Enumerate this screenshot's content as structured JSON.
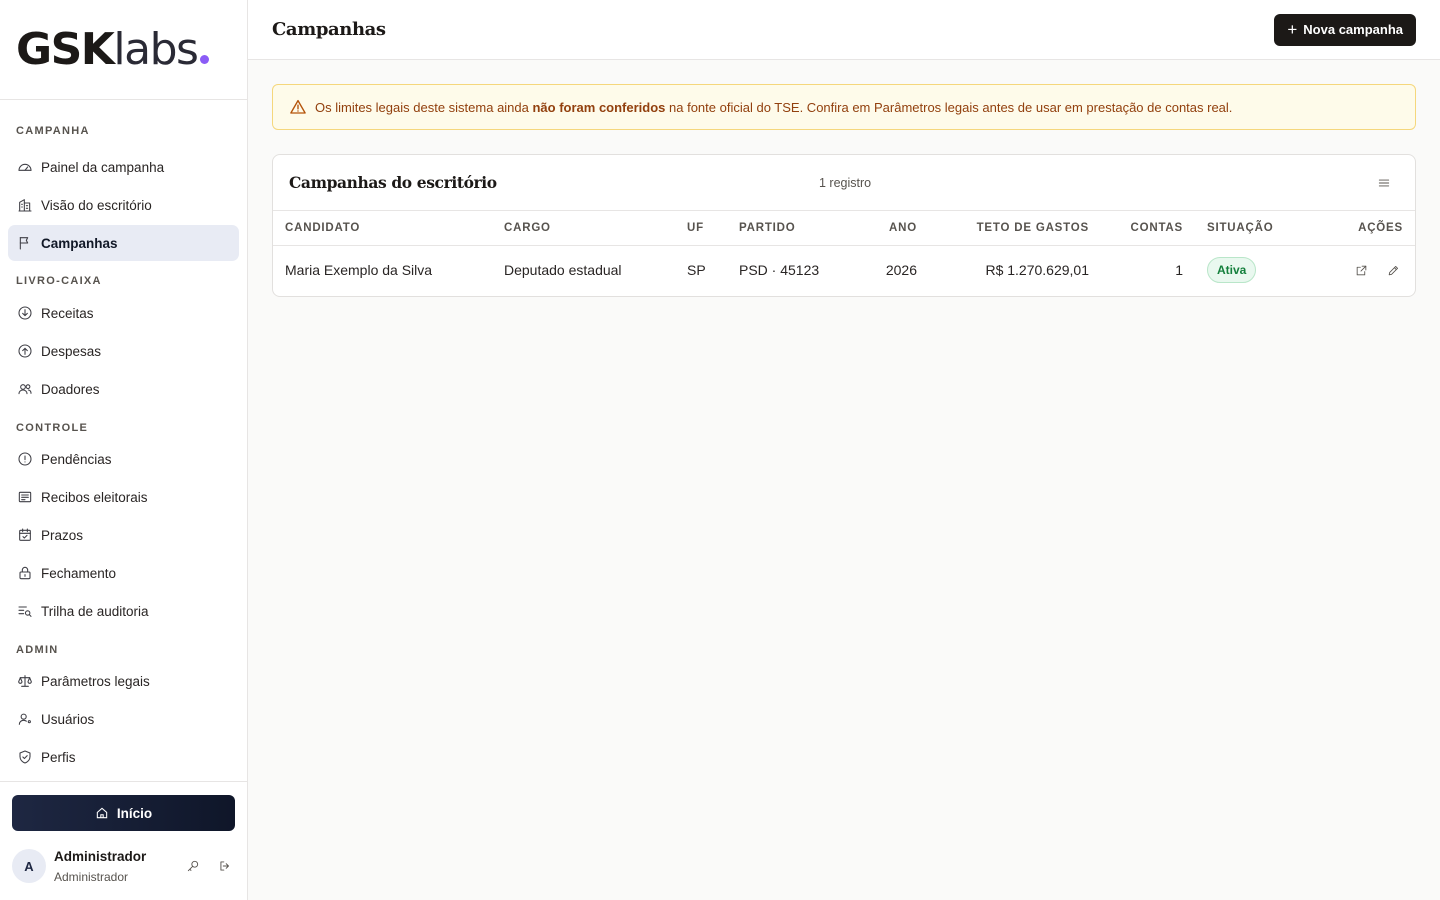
{
  "brand": {
    "bold": "GSK",
    "light": "labs",
    "dot_color": "#8b5cf6"
  },
  "sidebar": {
    "sections": [
      {
        "label": "CAMPANHA",
        "items": [
          {
            "label": "Painel da campanha",
            "icon": "gauge-icon"
          },
          {
            "label": "Visão do escritório",
            "icon": "building-icon"
          },
          {
            "label": "Campanhas",
            "icon": "flag-icon",
            "active": true
          }
        ]
      },
      {
        "label": "LIVRO-CAIXA",
        "items": [
          {
            "label": "Receitas",
            "icon": "arrow-down-circle-icon"
          },
          {
            "label": "Despesas",
            "icon": "arrow-up-circle-icon"
          },
          {
            "label": "Doadores",
            "icon": "users-icon"
          }
        ]
      },
      {
        "label": "CONTROLE",
        "items": [
          {
            "label": "Pendências",
            "icon": "alert-circle-icon"
          },
          {
            "label": "Recibos eleitorais",
            "icon": "receipt-icon"
          },
          {
            "label": "Prazos",
            "icon": "calendar-check-icon"
          },
          {
            "label": "Fechamento",
            "icon": "lock-icon"
          },
          {
            "label": "Trilha de auditoria",
            "icon": "list-search-icon"
          }
        ]
      },
      {
        "label": "ADMIN",
        "items": [
          {
            "label": "Parâmetros legais",
            "icon": "scale-icon"
          },
          {
            "label": "Usuários",
            "icon": "user-plus-icon"
          },
          {
            "label": "Perfis",
            "icon": "shield-check-icon"
          }
        ]
      }
    ],
    "home_button": "Início",
    "user": {
      "initial": "A",
      "name": "Administrador",
      "role": "Administrador"
    }
  },
  "header": {
    "title": "Campanhas",
    "new_button": "Nova campanha"
  },
  "alert": {
    "text_before": "Os limites legais deste sistema ainda ",
    "text_bold": "não foram conferidos",
    "text_after": " na fonte oficial do TSE. Confira em Parâmetros legais antes de usar em prestação de contas real."
  },
  "card": {
    "title": "Campanhas do escritório",
    "count": "1 registro",
    "columns": [
      "CANDIDATO",
      "CARGO",
      "UF",
      "PARTIDO",
      "ANO",
      "TETO DE GASTOS",
      "CONTAS",
      "SITUAÇÃO",
      "AÇÕES"
    ],
    "rows": [
      {
        "candidato": "Maria Exemplo da Silva",
        "cargo": "Deputado estadual",
        "uf": "SP",
        "partido": "PSD · 45123",
        "ano": "2026",
        "teto": "R$ 1.270.629,01",
        "contas": "1",
        "situacao": "Ativa"
      }
    ]
  }
}
